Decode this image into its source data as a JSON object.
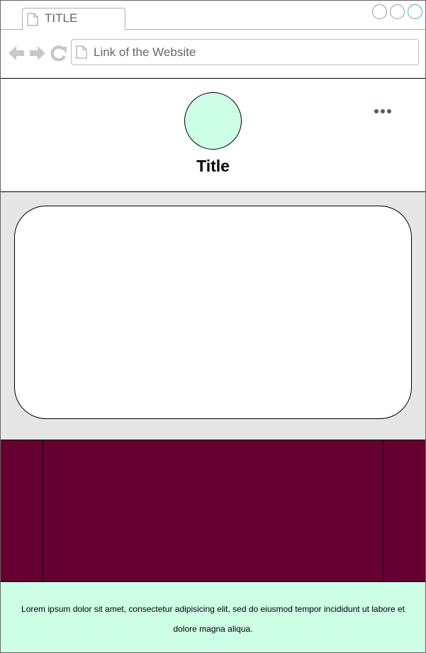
{
  "browser": {
    "tab": {
      "title": "TITLE",
      "icon": "page-icon"
    },
    "window_controls": [
      "minimize-icon",
      "maximize-icon",
      "close-icon"
    ],
    "nav": {
      "back_icon": "back-arrow-icon",
      "forward_icon": "forward-arrow-icon",
      "reload_icon": "reload-icon"
    },
    "address": {
      "url": "Link of the Website",
      "icon": "page-icon"
    }
  },
  "header": {
    "title": "Title",
    "avatar_color": "#ccffe6",
    "menu_icon": "more-horizontal-icon"
  },
  "media": {
    "background": "#e6e6e6",
    "card_color": "#ffffff"
  },
  "band": {
    "color": "#660033"
  },
  "footer": {
    "text": "Lorem ipsum dolor sit amet, consectetur adipisicing elit, sed do eiusmod tempor incididunt ut labore et dolore magna aliqua.",
    "background": "#ccffe6"
  }
}
